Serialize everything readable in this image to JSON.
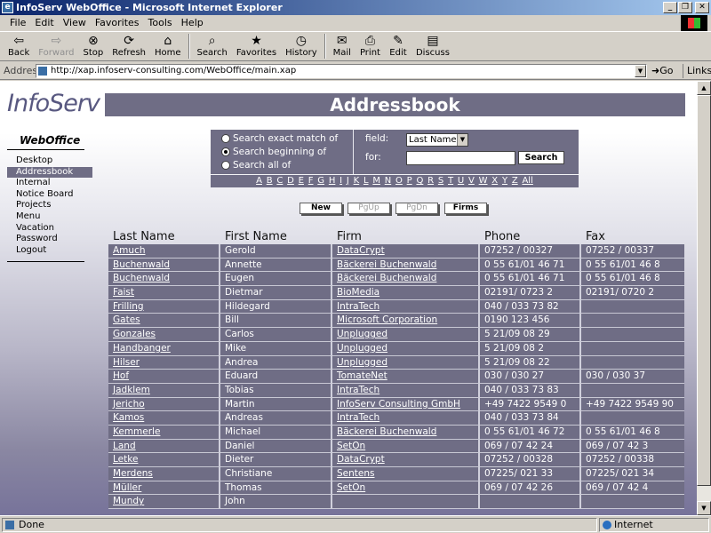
{
  "window": {
    "title": "InfoServ WebOffice - Microsoft Internet Explorer"
  },
  "menu": [
    "File",
    "Edit",
    "View",
    "Favorites",
    "Tools",
    "Help"
  ],
  "toolbar": {
    "back": "Back",
    "forward": "Forward",
    "stop": "Stop",
    "refresh": "Refresh",
    "home": "Home",
    "search": "Search",
    "favorites": "Favorites",
    "history": "History",
    "mail": "Mail",
    "print": "Print",
    "edit": "Edit",
    "discuss": "Discuss"
  },
  "address": {
    "label": "Address",
    "url": "http://xap.infoserv-consulting.com/WebOffice/main.xap",
    "go": "Go",
    "links": "Links"
  },
  "logo": {
    "brand": "InfoServ",
    "sub": "WebOffice"
  },
  "nav": [
    "Desktop",
    "Addressbook",
    "Internal",
    "Notice Board",
    "Projects",
    "Menu",
    "Vacation",
    "Password",
    "Logout"
  ],
  "header": {
    "title": "Addressbook"
  },
  "search": {
    "options": [
      "Search exact match of",
      "Search beginning of",
      "Search all of"
    ],
    "selected_option": 1,
    "field_label": "field:",
    "field_value": "Last Name",
    "for_label": "for:",
    "for_value": "",
    "button": "Search"
  },
  "alphabet": [
    "A",
    "B",
    "C",
    "D",
    "E",
    "F",
    "G",
    "H",
    "I",
    "J",
    "K",
    "L",
    "M",
    "N",
    "O",
    "P",
    "Q",
    "R",
    "S",
    "T",
    "U",
    "V",
    "W",
    "X",
    "Y",
    "Z",
    "All"
  ],
  "actions": {
    "new": "New",
    "pgup": "PgUp",
    "pgdn": "PgDn",
    "firms": "Firms"
  },
  "table": {
    "headers": [
      "Last Name",
      "First Name",
      "Firm",
      "Phone",
      "Fax"
    ],
    "rows": [
      [
        "Amuch",
        "Gerold",
        "DataCrypt",
        "07252 / 00327",
        "07252 / 00337"
      ],
      [
        "Buchenwald",
        "Annette",
        "Bäckerei Buchenwald",
        "0 55 61/01 46 71",
        "0 55 61/01 46 8"
      ],
      [
        "Buchenwald",
        "Eugen",
        "Bäckerei Buchenwald",
        "0 55 61/01 46 71",
        "0 55 61/01 46 8"
      ],
      [
        "Faist",
        "Dietmar",
        "BioMedia",
        "02191/ 0723 2",
        "02191/ 0720 2"
      ],
      [
        "Frilling",
        "Hildegard",
        "IntraTech",
        "040 / 033 73 82",
        ""
      ],
      [
        "Gates",
        "Bill",
        "Microsoft Corporation",
        "0190 123 456",
        ""
      ],
      [
        "Gonzales",
        "Carlos",
        "Unplugged",
        "5 21/09 08 29",
        ""
      ],
      [
        "Handbanger",
        "Mike",
        "Unplugged",
        "5 21/09 08 2",
        ""
      ],
      [
        "Hilser",
        "Andrea",
        "Unplugged",
        "5 21/09 08 22",
        ""
      ],
      [
        "Hof",
        "Eduard",
        "TomateNet",
        "030 / 030 27",
        "030 / 030 37"
      ],
      [
        "Jadklem",
        "Tobias",
        "IntraTech",
        "040 / 033 73 83",
        ""
      ],
      [
        "Jericho",
        "Martin",
        "InfoServ Consulting GmbH",
        "+49 7422 9549 0",
        "+49 7422 9549 90"
      ],
      [
        "Kamos",
        "Andreas",
        "IntraTech",
        "040 / 033 73 84",
        ""
      ],
      [
        "Kemmerle",
        "Michael",
        "Bäckerei Buchenwald",
        "0 55 61/01 46 72",
        "0 55 61/01 46 8"
      ],
      [
        "Land",
        "Daniel",
        "SetOn",
        "069 / 07 42 24",
        "069 / 07 42 3"
      ],
      [
        "Letke",
        "Dieter",
        "DataCrypt",
        "07252 / 00328",
        "07252 / 00338"
      ],
      [
        "Merdens",
        "Christiane",
        "Sentens",
        "07225/ 021 33",
        "07225/ 021 34"
      ],
      [
        "Müller",
        "Thomas",
        "SetOn",
        "069 / 07 42 26",
        "069 / 07 42 4"
      ],
      [
        "Mundy",
        "John",
        "",
        "",
        ""
      ]
    ]
  },
  "status": {
    "text": "Done",
    "zone": "Internet"
  }
}
